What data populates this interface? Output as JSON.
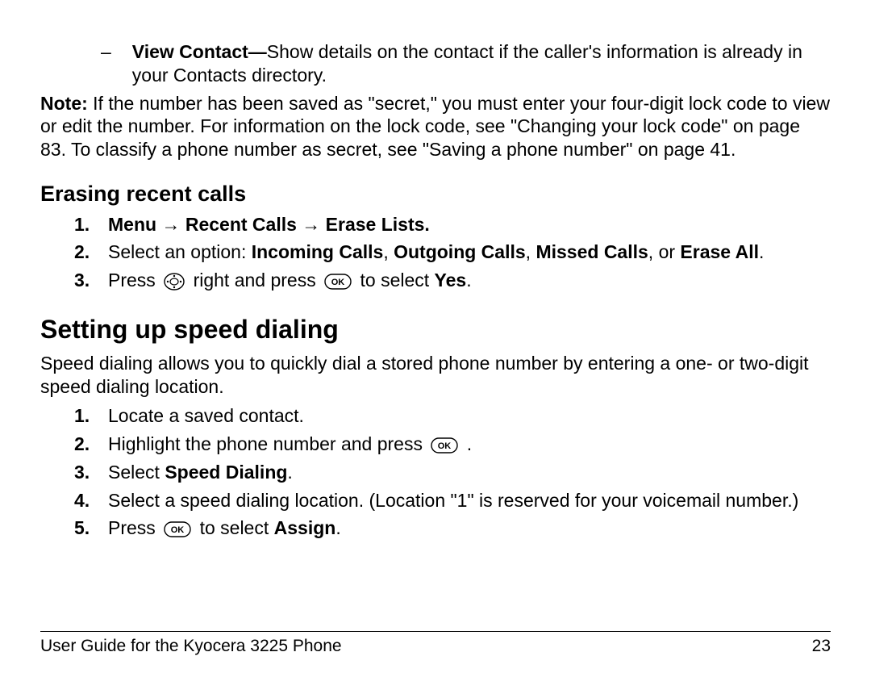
{
  "bullet1": {
    "dash": "–",
    "bold": "View Contact—",
    "rest": "Show details on the contact if the caller's information is already in your Contacts directory."
  },
  "note": {
    "bold": "Note:",
    "text": " If the number has been saved as \"secret,\" you must enter your four-digit lock code to view or edit the number. For information on the lock code, see \"Changing your lock code\" on page 83. To classify a phone number as secret, see \"Saving a phone number\" on page 41."
  },
  "subhead1": "Erasing recent calls",
  "erase": {
    "n1": "1.",
    "i1": "Menu → Recent Calls → Erase Lists.",
    "n2": "2.",
    "i2a": "Select an option: ",
    "i2b": "Incoming Calls",
    "i2c": ", ",
    "i2d": "Outgoing Calls",
    "i2e": ", ",
    "i2f": "Missed Calls",
    "i2g": ", or ",
    "i2h": "Erase All",
    "i2i": ".",
    "n3": "3.",
    "i3a": "Press ",
    "i3b": " right and press ",
    "i3c": " to select ",
    "i3d": "Yes",
    "i3e": "."
  },
  "mainhead": "Setting up speed dialing",
  "intro": "Speed dialing allows you to quickly dial a stored phone number by entering a one- or two-digit speed dialing location.",
  "speed": {
    "n1": "1.",
    "i1": "Locate a saved contact.",
    "n2": "2.",
    "i2a": "Highlight the phone number and press ",
    "i2b": " .",
    "n3": "3.",
    "i3a": "Select ",
    "i3b": "Speed Dialing",
    "i3c": ".",
    "n4": "4.",
    "i4": "Select a speed dialing location. (Location \"1\" is reserved for your voicemail number.)",
    "n5": "5.",
    "i5a": "Press ",
    "i5b": " to select ",
    "i5c": "Assign",
    "i5d": "."
  },
  "footer": {
    "left": "User Guide for the Kyocera 3225 Phone",
    "right": "23"
  }
}
